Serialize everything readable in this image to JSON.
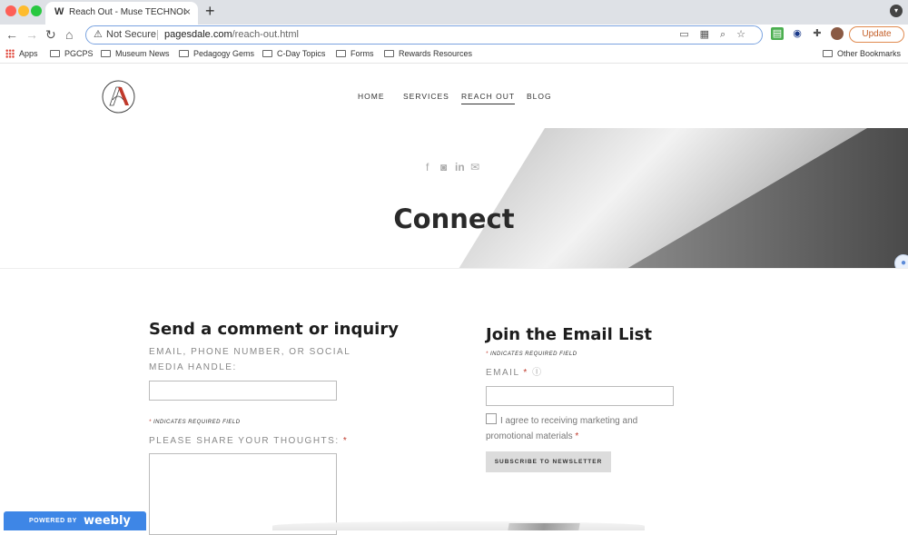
{
  "browser": {
    "tab_title": "Reach Out - Muse TECHNOLOGY",
    "tab_close": "×",
    "tab_new": "+",
    "tab_favicon": "W",
    "not_secure": "Not Secure",
    "url_host": "pagesdale.com",
    "url_path": "/reach-out.html",
    "update_label": "Update",
    "bookmarks": [
      "Apps",
      "PGCPS",
      "Museum News",
      "Pedagogy Gems",
      "C-Day Topics",
      "Forms",
      "Rewards Resources"
    ],
    "other_bookmarks": "Other Bookmarks"
  },
  "site": {
    "nav": [
      "HOME",
      "SERVICES",
      "REACH OUT",
      "BLOG"
    ],
    "active_nav": "REACH OUT",
    "hero_title": "Connect",
    "social_icons": [
      "facebook-icon",
      "instagram-icon",
      "linkedin-icon",
      "mail-icon"
    ]
  },
  "contact": {
    "title": "Send a comment or inquiry",
    "handle_label_line1": "EMAIL, PHONE NUMBER, OR SOCIAL",
    "handle_label_line2": "MEDIA HANDLE:",
    "required_note": "INDICATES REQUIRED FIELD",
    "thoughts_label": "PLEASE SHARE YOUR THOUGHTS:"
  },
  "newsletter": {
    "title": "Join the Email List",
    "required_note": "INDICATES REQUIRED FIELD",
    "email_label": "EMAIL",
    "agree_line1": "I agree to receiving marketing and",
    "agree_line2": "promotional materials",
    "subscribe_label": "SUBSCRIBE TO NEWSLETTER"
  },
  "footer": {
    "powered": "POWERED BY",
    "brand": "weebly"
  },
  "colors": {
    "accent_link": "#3e86e6",
    "required_star": "#c0392b",
    "logo_red": "#c0392b"
  }
}
